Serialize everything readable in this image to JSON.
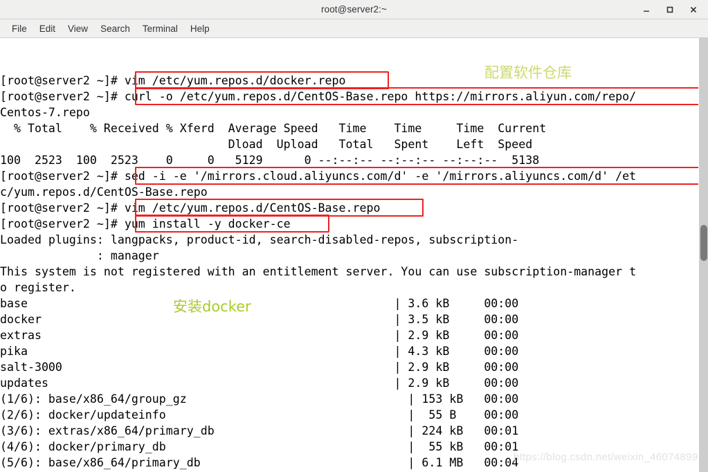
{
  "window": {
    "title": "root@server2:~",
    "buttons": [
      {
        "name": "minimize",
        "glyph": "—"
      },
      {
        "name": "maximize",
        "glyph": "□"
      },
      {
        "name": "close",
        "glyph": "✕"
      }
    ]
  },
  "menubar": {
    "items": [
      {
        "label": "File"
      },
      {
        "label": "Edit"
      },
      {
        "label": "View"
      },
      {
        "label": "Search"
      },
      {
        "label": "Terminal"
      },
      {
        "label": "Help"
      }
    ]
  },
  "terminal": {
    "prompt": "[root@server2 ~]# ",
    "lines": [
      {
        "text": "[root@server2 ~]# vim /etc/yum.repos.d/docker.repo"
      },
      {
        "text": "[root@server2 ~]# curl -o /etc/yum.repos.d/CentOS-Base.repo https://mirrors.aliyun.com/repo/"
      },
      {
        "text": "Centos-7.repo"
      },
      {
        "text": "  % Total    % Received % Xferd  Average Speed   Time    Time     Time  Current"
      },
      {
        "text": "                                 Dload  Upload   Total   Spent    Left  Speed"
      },
      {
        "text": "100  2523  100  2523    0     0   5129      0 --:--:-- --:--:-- --:--:--  5138"
      },
      {
        "text": "[root@server2 ~]# sed -i -e '/mirrors.cloud.aliyuncs.com/d' -e '/mirrors.aliyuncs.com/d' /et"
      },
      {
        "text": "c/yum.repos.d/CentOS-Base.repo"
      },
      {
        "text": "[root@server2 ~]# vim /etc/yum.repos.d/CentOS-Base.repo"
      },
      {
        "text": "[root@server2 ~]# yum install -y docker-ce"
      },
      {
        "text": "Loaded plugins: langpacks, product-id, search-disabled-repos, subscription-"
      },
      {
        "text": "              : manager"
      },
      {
        "text": "This system is not registered with an entitlement server. You can use subscription-manager t"
      },
      {
        "text": "o register."
      },
      {
        "text": "base                                                     | 3.6 kB     00:00"
      },
      {
        "text": "docker                                                   | 3.5 kB     00:00"
      },
      {
        "text": "extras                                                   | 2.9 kB     00:00"
      },
      {
        "text": "pika                                                     | 4.3 kB     00:00"
      },
      {
        "text": "salt-3000                                                | 2.9 kB     00:00"
      },
      {
        "text": "updates                                                  | 2.9 kB     00:00"
      },
      {
        "text": "(1/6): base/x86_64/group_gz                                | 153 kB   00:00"
      },
      {
        "text": "(2/6): docker/updateinfo                                   |  55 B    00:00"
      },
      {
        "text": "(3/6): extras/x86_64/primary_db                            | 224 kB   00:01"
      },
      {
        "text": "(4/6): docker/primary_db                                   |  55 kB   00:01"
      },
      {
        "text": "(5/6): base/x86_64/primary_db                              | 6.1 MB   00:04"
      }
    ],
    "commands": [
      {
        "name": "vim-docker-repo",
        "text": "vim /etc/yum.repos.d/docker.repo"
      },
      {
        "name": "curl-centos-base-repo",
        "text": "curl -o /etc/yum.repos.d/CentOS-Base.repo https://mirrors.aliyun.com/repo/Centos-7.repo"
      },
      {
        "name": "sed-remove-mirrors",
        "text": "sed -i -e '/mirrors.cloud.aliyuncs.com/d' -e '/mirrors.aliyuncs.com/d' /etc/yum.repos.d/CentOS-Base.repo"
      },
      {
        "name": "vim-centos-base-repo",
        "text": "vim /etc/yum.repos.d/CentOS-Base.repo"
      },
      {
        "name": "yum-install-docker-ce",
        "text": "yum install -y docker-ce"
      }
    ],
    "repos": [
      {
        "name": "base",
        "size": "3.6 kB",
        "time": "00:00"
      },
      {
        "name": "docker",
        "size": "3.5 kB",
        "time": "00:00"
      },
      {
        "name": "extras",
        "size": "2.9 kB",
        "time": "00:00"
      },
      {
        "name": "pika",
        "size": "4.3 kB",
        "time": "00:00"
      },
      {
        "name": "salt-3000",
        "size": "2.9 kB",
        "time": "00:00"
      },
      {
        "name": "updates",
        "size": "2.9 kB",
        "time": "00:00"
      }
    ],
    "downloads": [
      {
        "index": "(1/6)",
        "file": "base/x86_64/group_gz",
        "size": "153 kB",
        "time": "00:00"
      },
      {
        "index": "(2/6)",
        "file": "docker/updateinfo",
        "size": "55 B",
        "time": "00:00"
      },
      {
        "index": "(3/6)",
        "file": "extras/x86_64/primary_db",
        "size": "224 kB",
        "time": "00:01"
      },
      {
        "index": "(4/6)",
        "file": "docker/primary_db",
        "size": "55 kB",
        "time": "00:01"
      },
      {
        "index": "(5/6)",
        "file": "base/x86_64/primary_db",
        "size": "6.1 MB",
        "time": "00:04"
      }
    ],
    "curl_stats": {
      "header1": "  % Total    % Received % Xferd  Average Speed   Time    Time     Time  Current",
      "header2": "                                 Dload  Upload   Total   Spent    Left  Speed",
      "row": "100  2523  100  2523    0     0   5129      0 --:--:-- --:--:-- --:--:--  5138",
      "percent_total": "100",
      "total": "2523",
      "percent_received": "100",
      "received": "2523",
      "percent_xferd": "0",
      "xferd": "0",
      "dload": "5129",
      "upload": "0",
      "time_total": "--:--:--",
      "time_spent": "--:--:--",
      "time_left": "--:--:--",
      "current_speed": "5138"
    },
    "messages": {
      "loaded_plugins": "Loaded plugins: langpacks, product-id, search-disabled-repos, subscription-",
      "loaded_plugins_cont": "              : manager",
      "entitlement_1": "This system is not registered with an entitlement server. You can use subscription-manager t",
      "entitlement_2": "o register."
    }
  },
  "annotations": [
    {
      "name": "configure-repo-annotation",
      "text": "配置软件仓库",
      "color": "#cdd96a"
    },
    {
      "name": "install-docker-annotation",
      "text": "安装docker",
      "color": "#aacb28"
    }
  ],
  "watermark": {
    "text": "https://blog.csdn.net/weixin_46074899"
  },
  "scrollbar": {
    "position_percent": 47
  }
}
